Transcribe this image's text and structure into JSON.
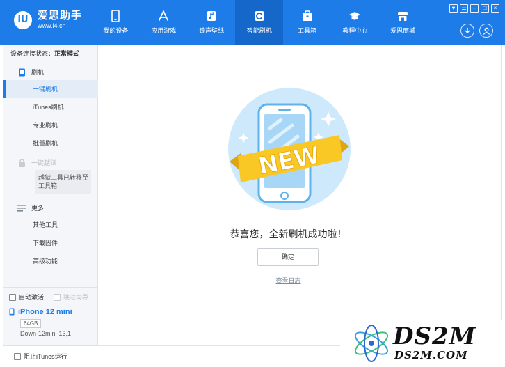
{
  "app": {
    "name": "爱思助手",
    "url": "www.i4.cn",
    "logo_glyph": "iU"
  },
  "nav": [
    {
      "label": "我的设备",
      "icon": "phone-icon"
    },
    {
      "label": "应用游戏",
      "icon": "appstore-icon"
    },
    {
      "label": "铃声壁纸",
      "icon": "music-icon"
    },
    {
      "label": "智能刷机",
      "icon": "refresh-icon",
      "active": true
    },
    {
      "label": "工具箱",
      "icon": "toolbox-icon"
    },
    {
      "label": "教程中心",
      "icon": "graduation-cap-icon"
    },
    {
      "label": "爱思商城",
      "icon": "store-icon"
    }
  ],
  "window_controls": [
    "♥",
    "☰",
    "–",
    "□",
    "×"
  ],
  "sidebar": {
    "status_label": "设备连接状态：",
    "status_value": "正常模式",
    "section_flash": "刷机",
    "flash_items": [
      "一键刷机",
      "iTunes刷机",
      "专业刷机",
      "批量刷机"
    ],
    "section_jailbreak": "一键越狱",
    "jailbreak_note_line1": "越狱工具已转移至",
    "jailbreak_note_line2": "工具箱",
    "section_more": "更多",
    "more_items": [
      "其他工具",
      "下载固件",
      "高级功能"
    ],
    "auto_activate": "自动激活",
    "skip_guide": "跳过向导"
  },
  "device": {
    "name": "iPhone 12 mini",
    "capacity": "64GB",
    "model": "Down-12mini-13,1"
  },
  "bottom": {
    "block_itunes": "阻止iTunes运行"
  },
  "main": {
    "badge_text": "NEW",
    "success_message": "恭喜您，全新刷机成功啦！",
    "ok_button": "确定",
    "view_log": "查看日志"
  },
  "watermark": {
    "title": "DS2M",
    "subtitle": "DS2M.COM"
  },
  "colors": {
    "primary": "#1d7ce8",
    "nav_active": "#1568c9",
    "circle": "#cde9fb",
    "ribbon": "#f9c824"
  }
}
